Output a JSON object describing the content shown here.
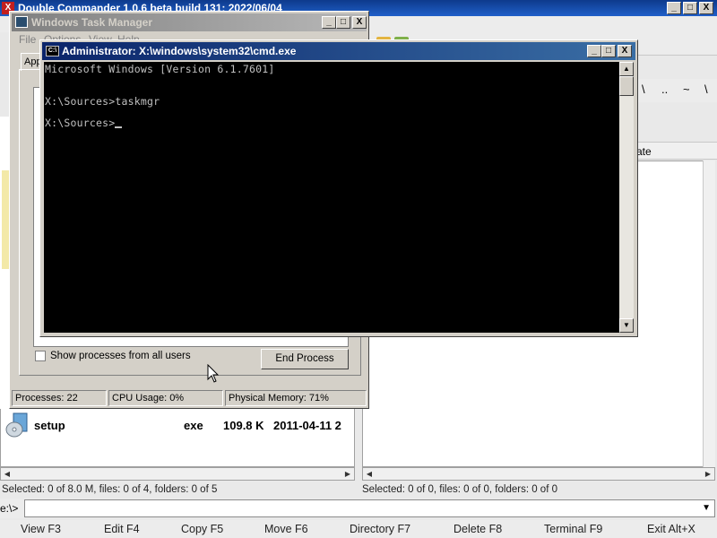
{
  "dc": {
    "title": "Double Commander 1.0.6 beta build 131; 2022/06/04",
    "right_header_col": "ate",
    "right_path_buttons": [
      "\\",
      "..",
      "~",
      "\\"
    ],
    "file": {
      "name": "setup",
      "ext": "exe",
      "size": "109.8 K",
      "date": "2011-04-11 2"
    },
    "status_left": "Selected: 0 of 8.0 M, files: 0 of 4, folders: 0 of 5",
    "status_right": "Selected: 0 of 0, files: 0 of 0, folders: 0 of 0",
    "cmd_prompt": "e:\\>",
    "fkeys": [
      "View F3",
      "Edit F4",
      "Copy F5",
      "Move F6",
      "Directory F7",
      "Delete F8",
      "Terminal F9",
      "Exit Alt+X"
    ]
  },
  "taskmgr": {
    "title": "Windows Task Manager",
    "menu": [
      "File",
      "Options",
      "View",
      "Help"
    ],
    "tab_label": "App",
    "show_all_label": "Show processes from all users",
    "end_process_label": "End Process",
    "processes": "Processes: 22",
    "cpu": "CPU Usage: 0%",
    "memory": "Physical Memory: 71%"
  },
  "cmd": {
    "title": "Administrator: X:\\windows\\system32\\cmd.exe",
    "icon_text": "C:\\",
    "lines": [
      "Microsoft Windows [Version 6.1.7601]",
      "",
      "X:\\Sources>taskmgr",
      "",
      "X:\\Sources>"
    ]
  },
  "window_buttons": {
    "minimize": "_",
    "maximize": "□",
    "close": "X"
  },
  "colors": {
    "cmd_titlebar": "#0a246a",
    "console_bg": "#000000",
    "console_text": "#c0c0c0"
  }
}
